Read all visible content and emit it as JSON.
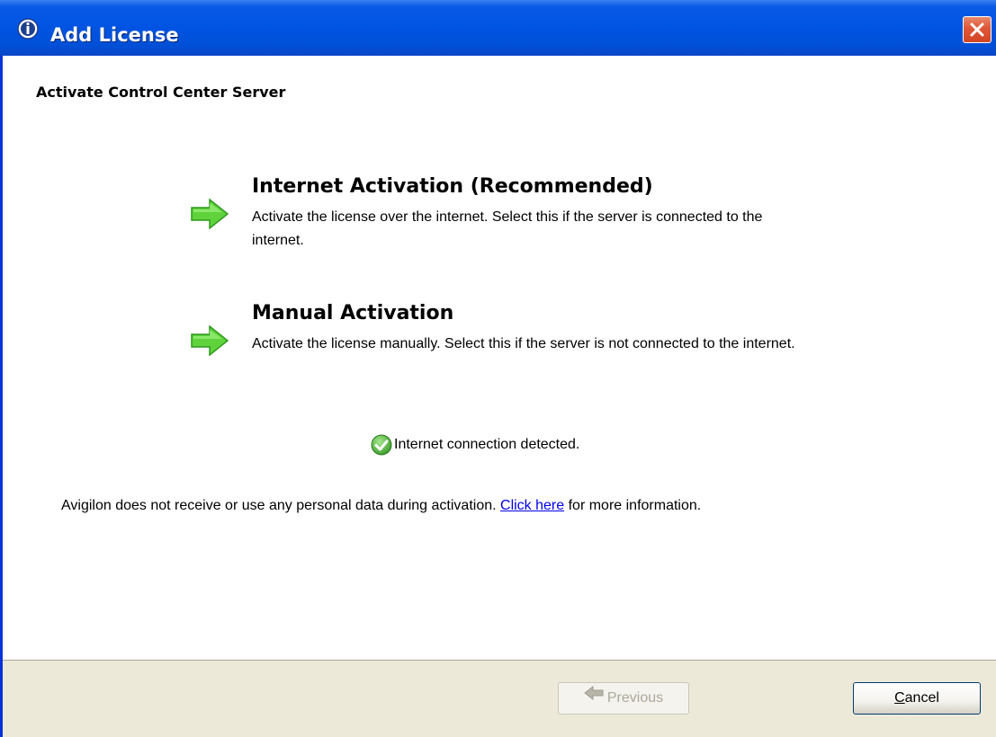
{
  "window": {
    "title": "Add License"
  },
  "header": {
    "label": "Activate Control Center Server"
  },
  "options": [
    {
      "title": "Internet Activation (Recommended)",
      "description": "Activate the license over the internet.  Select this if the server is connected to the internet.",
      "icon": "green-arrow-right-icon"
    },
    {
      "title": "Manual Activation",
      "description": "Activate the license manually.  Select this if the server is not connected to the internet.",
      "icon": "green-arrow-right-icon"
    }
  ],
  "status": {
    "text": "Internet connection detected.",
    "icon": "green-check-icon"
  },
  "privacy": {
    "prefix": "Avigilon does not receive or use any personal data during activation. ",
    "link_text": "Click here",
    "suffix": " for more information."
  },
  "buttons": {
    "previous_label": "Previous",
    "previous_enabled": false,
    "cancel_mnemonic": "C",
    "cancel_rest": "ancel"
  },
  "colors": {
    "titlebar": "#0054e3",
    "close_button": "#e0593a",
    "arrow": "#5fd23c",
    "link": "#0000ee",
    "footer": "#ece9d8"
  }
}
